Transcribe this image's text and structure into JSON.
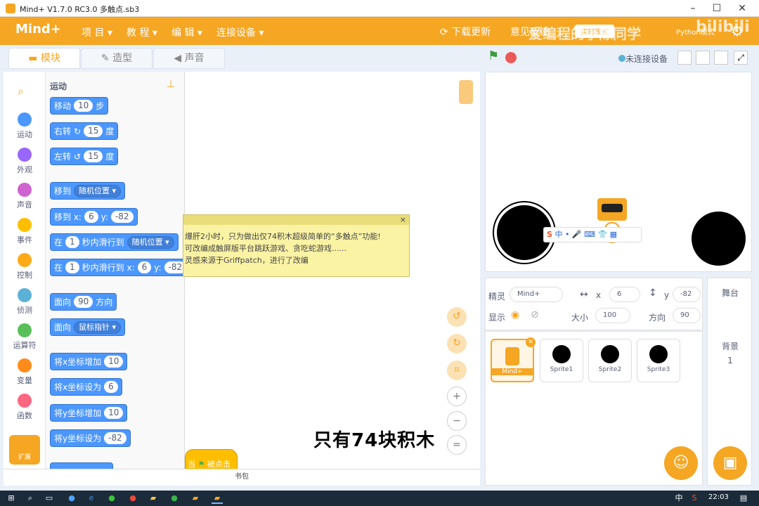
{
  "window": {
    "title": "Mind+ V1.7.0 RC3.0   多触点.sb3",
    "min": "–",
    "max": "☐",
    "close": "✕"
  },
  "menubar": {
    "logo": "Mind+",
    "items": [
      "项 目",
      "教 程",
      "编 辑",
      "连接设备"
    ],
    "download": "下载更新",
    "feedback": "意见反馈",
    "mode_btn": "实时模式",
    "python": "Python模式",
    "watermark": "爱编程的小陈同学",
    "bilibili": "bilibili"
  },
  "tabs": {
    "blocks": "模块",
    "costumes": "造型",
    "sounds": "声音"
  },
  "stage_controls": {
    "connect": "未连接设备"
  },
  "categories": [
    {
      "label": "运动",
      "color": "#4c97ff"
    },
    {
      "label": "外观",
      "color": "#9966ff"
    },
    {
      "label": "声音",
      "color": "#cf63cf"
    },
    {
      "label": "事件",
      "color": "#ffbf00"
    },
    {
      "label": "控制",
      "color": "#ffab19"
    },
    {
      "label": "侦测",
      "color": "#5cb1d6"
    },
    {
      "label": "运算符",
      "color": "#59c059"
    },
    {
      "label": "变量",
      "color": "#ff8c1a"
    },
    {
      "label": "函数",
      "color": "#ff6680"
    }
  ],
  "extension": "扩展",
  "palette": {
    "heading": "运动",
    "b_move": {
      "pre": "移动",
      "v": "10",
      "post": "步"
    },
    "b_turn_r": {
      "pre": "右转",
      "v": "15",
      "post": "度"
    },
    "b_turn_l": {
      "pre": "左转",
      "v": "15",
      "post": "度"
    },
    "b_goto": {
      "pre": "移到",
      "opt": "随机位置"
    },
    "b_goxy": {
      "a": "移到 x:",
      "x": "6",
      "b": "y:",
      "y": "-82"
    },
    "b_glide": {
      "a": "在",
      "v": "1",
      "b": "秒内滑行到",
      "opt": "随机位置"
    },
    "b_glidexy": {
      "a": "在",
      "v": "1",
      "b": "秒内滑行到 x:",
      "x": "6",
      "c": "y:",
      "y": "-82"
    },
    "b_dir": {
      "a": "面向",
      "v": "90",
      "b": "方向"
    },
    "b_face": {
      "a": "面向",
      "opt": "鼠标指针"
    },
    "b_chx": {
      "a": "将x坐标增加",
      "v": "10"
    },
    "b_setx": {
      "a": "将x坐标设为",
      "v": "6"
    },
    "b_chy": {
      "a": "将y坐标增加",
      "v": "10"
    },
    "b_sety": {
      "a": "将y坐标设为",
      "v": "-82"
    }
  },
  "note": {
    "lines": [
      "爆肝2小时，只为做出仅74积木超级简单的“多触点”功能!",
      "可改编成触屏版平台跳跃游戏、贪吃蛇游戏......",
      "灵感来源于Griffpatch，进行了改编"
    ],
    "close": "×"
  },
  "hat_block": {
    "a": "当",
    "b": "被点击"
  },
  "caption": "只有74块积木",
  "backpack": "书包",
  "sprite_info": {
    "label_sprite": "精灵",
    "name": "Mind+",
    "label_x": "x",
    "x": "6",
    "label_y": "y",
    "y": "-82",
    "label_show": "显示",
    "label_size": "大小",
    "size": "100",
    "label_dir": "方向",
    "dir": "90"
  },
  "sprites": [
    {
      "name": "Mind+"
    },
    {
      "name": "Sprite1"
    },
    {
      "name": "Sprite2"
    },
    {
      "name": "Sprite3"
    }
  ],
  "stage_panel": {
    "title": "舞台",
    "backdrop_label": "背景",
    "backdrop_count": "1"
  },
  "ime": {
    "lang": "中"
  },
  "taskbar": {
    "time": "22:03",
    "lang": "中"
  }
}
